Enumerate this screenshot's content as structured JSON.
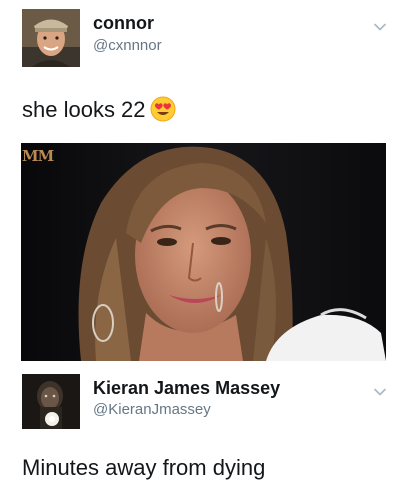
{
  "tweets": [
    {
      "display_name": "connor",
      "handle": "@cxnnnor",
      "text": "she looks 22",
      "emoji": "heart-eyes-emoji",
      "media": {
        "overlay_text": "MM"
      }
    },
    {
      "display_name": "Kieran James Massey",
      "handle": "@KieranJmassey",
      "text": "Minutes away from dying"
    }
  ]
}
